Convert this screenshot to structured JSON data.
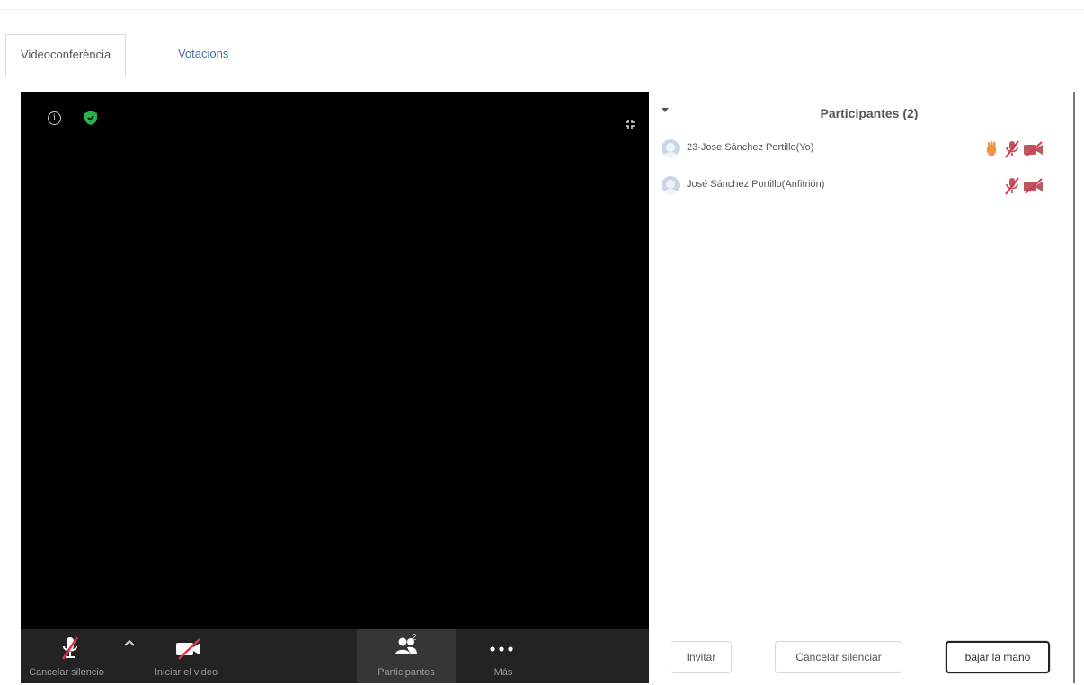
{
  "tabs": [
    {
      "label": "Videoconferència",
      "active": true
    },
    {
      "label": "Votacions",
      "active": false
    }
  ],
  "video": {
    "toolbar": {
      "mute_label": "Cancelar silencio",
      "video_label": "Iniciar el video",
      "participants_label": "Participantes",
      "participants_count": "2",
      "more_label": "Más"
    }
  },
  "panel": {
    "title": "Participantes (2)",
    "participants": [
      {
        "name": "23-Jose Sánchez Portillo(Yo)",
        "hand_raised": true,
        "mic_muted": true,
        "camera_off": true
      },
      {
        "name": "José Sánchez Portillo(Anfitrión)",
        "hand_raised": false,
        "mic_muted": true,
        "camera_off": true
      }
    ],
    "buttons": {
      "invite": "Invitar",
      "unmute_all": "Cancelar silenciar",
      "lower_hand": "bajar la mano"
    }
  },
  "colors": {
    "mute_red": "#e0334a",
    "muted_icon": "#b8585f",
    "hand_orange": "#f5923e",
    "shield_green": "#23b44a",
    "tab_link": "#4a6ea9"
  }
}
